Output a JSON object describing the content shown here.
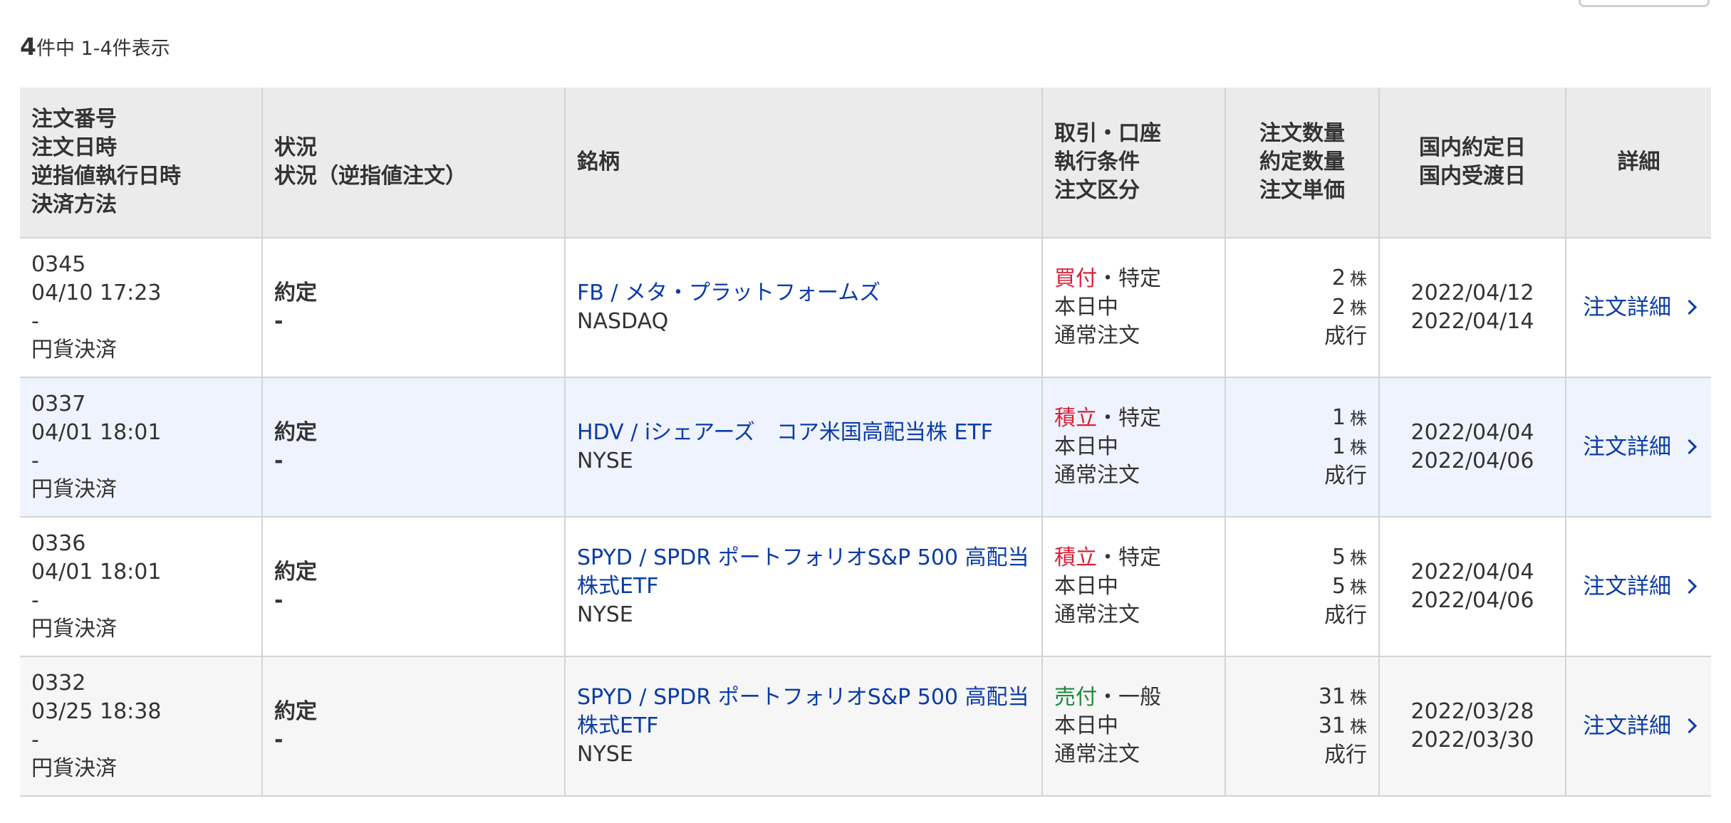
{
  "summary": {
    "total": "4",
    "text": "件中 1-4件表示"
  },
  "headers": [
    [
      "注文番号",
      "注文日時",
      "逆指値執行日時",
      "決済方法"
    ],
    [
      "状況",
      "状況（逆指値注文）"
    ],
    [
      "銘柄"
    ],
    [
      "取引・口座",
      "執行条件",
      "注文区分"
    ],
    [
      "注文数量",
      "約定数量",
      "注文単価"
    ],
    [
      "国内約定日",
      "国内受渡日"
    ],
    [
      "詳細"
    ]
  ],
  "rows": [
    {
      "order_no": "0345",
      "order_datetime": "04/10 17:23",
      "stop_datetime": "-",
      "settlement": "円貨決済",
      "status": "約定",
      "stop_status": "-",
      "symbol_lines": [
        "FB / メタ・プラットフォームズ"
      ],
      "market": "NASDAQ",
      "trade_type": "買付",
      "trade_type_color": "#d6223a",
      "account": "・特定",
      "condition": "本日中",
      "order_class": "通常注文",
      "order_qty": "2",
      "filled_qty": "2",
      "unit": "株",
      "price": "成行",
      "exec_date": "2022/04/12",
      "settle_date": "2022/04/14",
      "detail_label": "注文詳細"
    },
    {
      "order_no": "0337",
      "order_datetime": "04/01 18:01",
      "stop_datetime": "-",
      "settlement": "円貨決済",
      "status": "約定",
      "stop_status": "-",
      "symbol_lines": [
        "HDV / iシェアーズ　コア米国高配当株 ETF"
      ],
      "market": "NYSE",
      "trade_type": "積立",
      "trade_type_color": "#d6223a",
      "account": "・特定",
      "condition": "本日中",
      "order_class": "通常注文",
      "order_qty": "1",
      "filled_qty": "1",
      "unit": "株",
      "price": "成行",
      "exec_date": "2022/04/04",
      "settle_date": "2022/04/06",
      "detail_label": "注文詳細"
    },
    {
      "order_no": "0336",
      "order_datetime": "04/01 18:01",
      "stop_datetime": "-",
      "settlement": "円貨決済",
      "status": "約定",
      "stop_status": "-",
      "symbol_lines": [
        "SPYD / SPDR ポートフォリオS&P 500 高配当",
        "株式ETF"
      ],
      "market": "NYSE",
      "trade_type": "積立",
      "trade_type_color": "#d6223a",
      "account": "・特定",
      "condition": "本日中",
      "order_class": "通常注文",
      "order_qty": "5",
      "filled_qty": "5",
      "unit": "株",
      "price": "成行",
      "exec_date": "2022/04/04",
      "settle_date": "2022/04/06",
      "detail_label": "注文詳細"
    },
    {
      "order_no": "0332",
      "order_datetime": "03/25 18:38",
      "stop_datetime": "-",
      "settlement": "円貨決済",
      "status": "約定",
      "stop_status": "-",
      "symbol_lines": [
        "SPYD / SPDR ポートフォリオS&P 500 高配当",
        "株式ETF"
      ],
      "market": "NYSE",
      "trade_type": "売付",
      "trade_type_color": "#1f8a3c",
      "account": "・一般",
      "condition": "本日中",
      "order_class": "通常注文",
      "order_qty": "31",
      "filled_qty": "31",
      "unit": "株",
      "price": "成行",
      "exec_date": "2022/03/28",
      "settle_date": "2022/03/30",
      "detail_label": "注文詳細"
    }
  ]
}
